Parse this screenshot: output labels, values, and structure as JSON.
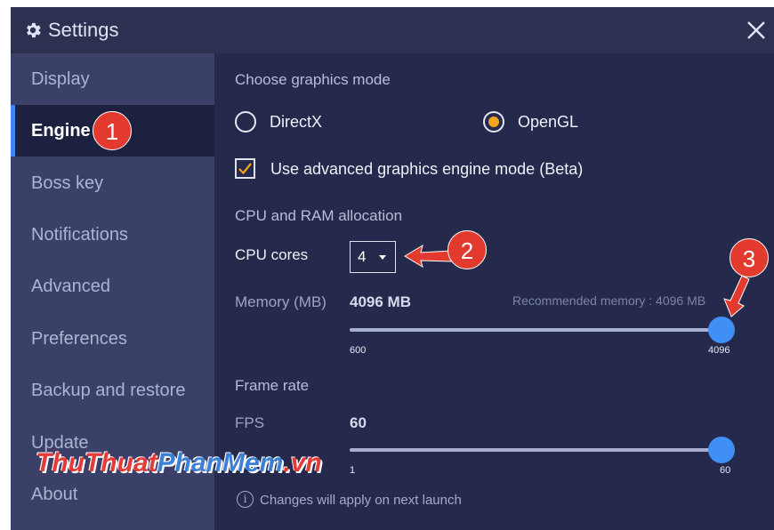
{
  "window": {
    "title": "Settings",
    "title_icon": "gear-icon",
    "close_icon": "close-icon"
  },
  "sidebar": {
    "items": [
      {
        "label": "Display",
        "active": false
      },
      {
        "label": "Engine",
        "active": true
      },
      {
        "label": "Boss key",
        "active": false
      },
      {
        "label": "Notifications",
        "active": false
      },
      {
        "label": "Advanced",
        "active": false
      },
      {
        "label": "Preferences",
        "active": false
      },
      {
        "label": "Backup and restore",
        "active": false
      },
      {
        "label": "Update",
        "active": false
      },
      {
        "label": "About",
        "active": false
      }
    ]
  },
  "graphics": {
    "section_title": "Choose graphics mode",
    "options": [
      {
        "label": "DirectX",
        "selected": false
      },
      {
        "label": "OpenGL",
        "selected": true
      }
    ],
    "advanced_mode": {
      "label": "Use advanced graphics engine mode (Beta)",
      "checked": true
    }
  },
  "allocation": {
    "section_title": "CPU and RAM allocation",
    "cpu": {
      "label": "CPU cores",
      "value": "4"
    },
    "memory": {
      "label": "Memory (MB)",
      "value_text": "4096 MB",
      "recommended": "Recommended memory : 4096 MB",
      "min": 600,
      "max": 4096,
      "value": 4096,
      "min_label": "600",
      "max_label": "4096"
    }
  },
  "frame_rate": {
    "section_title": "Frame rate",
    "fps_label": "FPS",
    "fps_value_text": "60",
    "min": 1,
    "max": 60,
    "value": 60,
    "min_label": "1",
    "max_label": "60"
  },
  "footer": {
    "note": "Changes will apply on next launch",
    "icon": "info-icon",
    "icon_glyph": "i"
  },
  "annotations": [
    {
      "number": "1",
      "color": "#e23a2f"
    },
    {
      "number": "2",
      "color": "#e23a2f"
    },
    {
      "number": "3",
      "color": "#e23a2f"
    }
  ],
  "watermark": {
    "part1": "ThuThuat",
    "part2": "PhanMem",
    "part3": ".vn"
  },
  "colors": {
    "window_bg": "#252a4c",
    "sidebar_bg": "#3b4068",
    "active_item_bg": "#1d2140",
    "accent_blue": "#3f8ff5",
    "radio_selected": "#f5a21c",
    "checkbox_tick": "#f5a21c",
    "annotation_red": "#e23a2f"
  }
}
